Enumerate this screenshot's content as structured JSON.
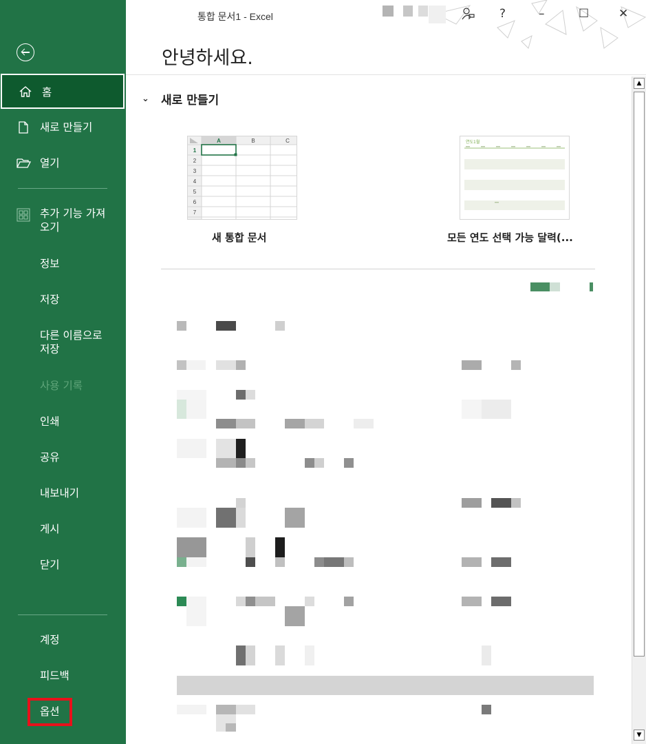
{
  "window": {
    "title": "통합 문서1 - Excel",
    "controls": {
      "coauthor": "coauthor-icon",
      "help": "?",
      "minimize": "–",
      "maximize": "☐",
      "close": "✕"
    }
  },
  "greeting": "안녕하세요.",
  "sidebar": {
    "back_icon": "back-arrow-icon",
    "home": "홈",
    "new": "새로 만들기",
    "open": "열기",
    "addins": "추가 기능 가져\n오기",
    "info": "정보",
    "save": "저장",
    "save_as": "다른 이름으로\n저장",
    "history": "사용 기록",
    "print": "인쇄",
    "share": "공유",
    "export": "내보내기",
    "publish": "게시",
    "close": "닫기",
    "account": "계정",
    "feedback": "피드백",
    "options": "옵션"
  },
  "new_section": {
    "title": "새로 만들기",
    "templates": [
      {
        "label": "새 통합 문서"
      },
      {
        "label": "모든 연도 선택 가능 달력(..."
      }
    ]
  },
  "workbook_thumb": {
    "cols": [
      "A",
      "B",
      "C"
    ],
    "rows": [
      "1",
      "2",
      "3",
      "4",
      "5",
      "6",
      "7"
    ]
  },
  "calendar_thumb": {
    "heading": "연도1월"
  },
  "colors": {
    "sidebar": "#217346",
    "home_active": "#0e5a2e",
    "highlight": "#e8111b",
    "accent": "#4a8f63"
  }
}
